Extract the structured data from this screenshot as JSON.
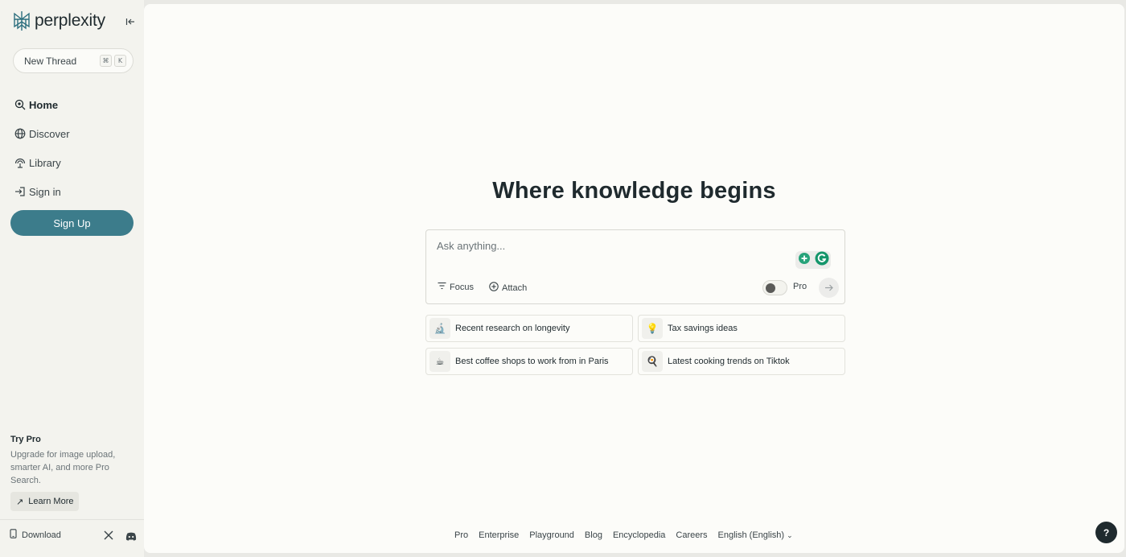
{
  "sidebar": {
    "brand": "perplexity",
    "new_thread": {
      "label": "New Thread",
      "shortcut": [
        "⌘",
        "K"
      ]
    },
    "nav": [
      {
        "label": "Home",
        "icon": "home-search-icon",
        "active": true
      },
      {
        "label": "Discover",
        "icon": "globe-icon"
      },
      {
        "label": "Library",
        "icon": "library-icon"
      },
      {
        "label": "Sign in",
        "icon": "sign-in-icon"
      }
    ],
    "signup_label": "Sign Up",
    "try_pro": {
      "title": "Try Pro",
      "description": "Upgrade for image upload, smarter AI, and more Pro Search.",
      "learn_more": "Learn More"
    },
    "download_label": "Download"
  },
  "main": {
    "headline": "Where knowledge begins",
    "search": {
      "placeholder": "Ask anything...",
      "focus_label": "Focus",
      "attach_label": "Attach",
      "pro_label": "Pro",
      "pro_enabled": false
    },
    "suggestions": [
      {
        "emoji": "🔬",
        "label": "Recent research on longevity"
      },
      {
        "emoji": "💡",
        "label": "Tax savings ideas"
      },
      {
        "emoji": "☕",
        "label": "Best coffee shops to work from in Paris"
      },
      {
        "emoji": "🍳",
        "label": "Latest cooking trends on Tiktok"
      }
    ]
  },
  "footer": {
    "links": [
      "Pro",
      "Enterprise",
      "Playground",
      "Blog",
      "Encyclopedia",
      "Careers"
    ],
    "language": "English (English)"
  },
  "help_label": "?",
  "colors": {
    "accent": "#3c7c8b",
    "sidebar_bg": "#f3f3ee",
    "main_bg": "#fcfcf9",
    "text": "#1f2a2e"
  }
}
